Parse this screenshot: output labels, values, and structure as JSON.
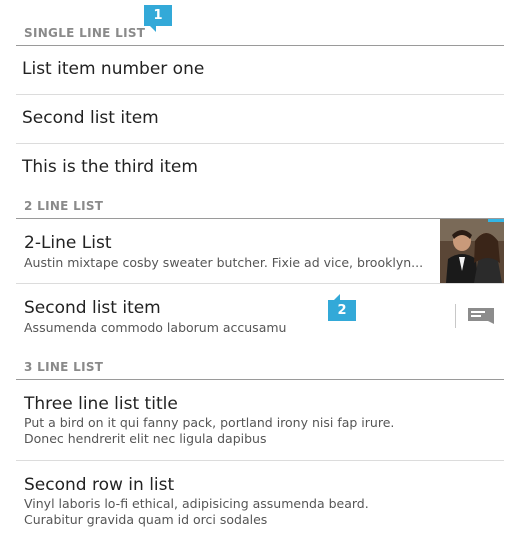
{
  "badges": {
    "one": "1",
    "two": "2"
  },
  "single_line": {
    "header": "SINGLE LINE LIST",
    "items": [
      "List item number one",
      "Second list item",
      "This is the third item"
    ]
  },
  "two_line": {
    "header": "2 LINE LIST",
    "items": [
      {
        "title": "2-Line List",
        "subtitle": "Austin mixtape cosby sweater butcher. Fixie ad vice, brooklyn..."
      },
      {
        "title": "Second list item",
        "subtitle": "Assumenda commodo laborum accusamu"
      }
    ]
  },
  "three_line": {
    "header": "3 LINE LIST",
    "items": [
      {
        "title": "Three line list title",
        "line1": "Put a bird on it qui fanny pack, portland irony nisi fap irure.",
        "line2": "Donec hendrerit elit nec ligula dapibus"
      },
      {
        "title": "Second row in list",
        "line1": "Vinyl laboris lo-fi ethical, adipisicing assumenda beard.",
        "line2": "Curabitur gravida quam id orci sodales"
      }
    ]
  },
  "icons": {
    "thumbnail": "photo-thumbnail",
    "action": "message-icon"
  },
  "colors": {
    "accent": "#33b5e5",
    "badge": "#33a9d8",
    "header_text": "#8a8a8a"
  }
}
